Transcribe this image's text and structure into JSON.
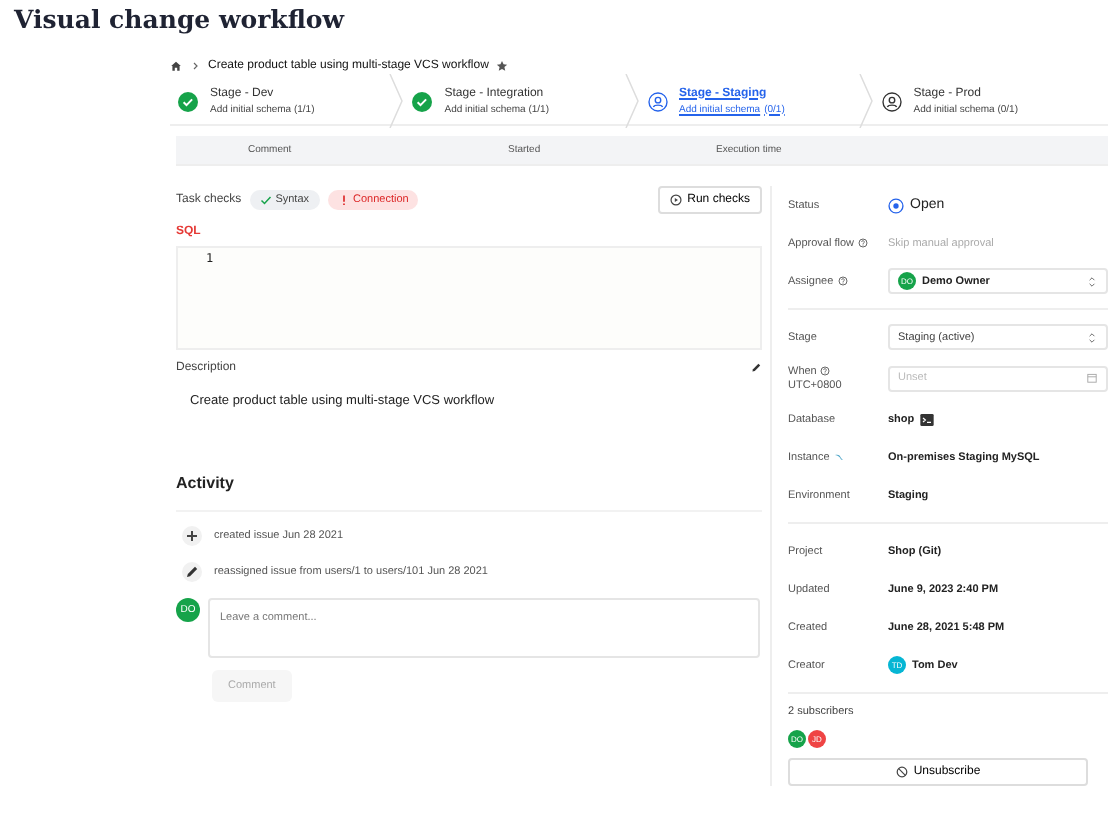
{
  "page_title": "Visual change workflow",
  "breadcrumb": {
    "title": "Create product table using multi-stage VCS workflow",
    "starred": true
  },
  "stages": [
    {
      "name": "Stage - Dev",
      "task": "Add initial schema (1/1)",
      "kind": "done",
      "selected": false
    },
    {
      "name": "Stage - Integration",
      "task": "Add initial schema (1/1)",
      "kind": "done",
      "selected": false
    },
    {
      "name": "Stage - Staging",
      "task": "Add initial schema",
      "count": "(0/1)",
      "kind": "active",
      "selected": true
    },
    {
      "name": "Stage - Prod",
      "task": "Add initial schema (0/1)",
      "kind": "pending",
      "selected": false
    }
  ],
  "table": {
    "columns": [
      "Comment",
      "Started",
      "Execution time"
    ]
  },
  "task_checks": {
    "label": "Task checks",
    "checks": [
      {
        "label": "Syntax",
        "kind": "success"
      },
      {
        "label": "Connection",
        "kind": "error"
      }
    ],
    "run_button": "Run checks"
  },
  "sql": {
    "label": "SQL",
    "lines": [
      "1"
    ]
  },
  "description": {
    "label": "Description",
    "text": "Create product table using multi-stage VCS workflow"
  },
  "activity": {
    "title": "Activity",
    "events": [
      {
        "kind": "create",
        "text": "created issue Jun 28 2021"
      },
      {
        "kind": "edit",
        "text": "reassigned issue from users/1 to users/101 Jun 28 2021"
      }
    ],
    "avatar": {
      "initials": "DO",
      "color": "#16a34a"
    },
    "comment_placeholder": "Leave a comment...",
    "comment_button": "Comment"
  },
  "sidebar": {
    "rows": [
      {
        "kind": "status",
        "label": "Status",
        "value": "Open"
      },
      {
        "kind": "muted",
        "label": "Approval flow",
        "help": true,
        "value": "Skip manual approval"
      },
      {
        "kind": "select",
        "label": "Assignee",
        "help": true,
        "value": "Demo Owner",
        "avatar": {
          "initials": "DO",
          "color": "#16a34a"
        }
      },
      {
        "kind": "divider"
      },
      {
        "kind": "select",
        "label": "Stage",
        "value": "Staging (active)"
      },
      {
        "kind": "date",
        "label": "When",
        "help": true,
        "sublabel": "UTC+0800",
        "placeholder": "Unset"
      },
      {
        "kind": "text",
        "label": "Database",
        "value": "shop",
        "terminal": true
      },
      {
        "kind": "text",
        "label": "Instance",
        "value": "On-premises Staging MySQL",
        "engine": true
      },
      {
        "kind": "text",
        "label": "Environment",
        "value": "Staging"
      },
      {
        "kind": "divider"
      },
      {
        "kind": "text",
        "label": "Project",
        "value": "Shop (Git)"
      },
      {
        "kind": "text",
        "label": "Updated",
        "value": "June 9, 2023 2:40 PM"
      },
      {
        "kind": "text",
        "label": "Created",
        "value": "June 28, 2021 5:48 PM"
      },
      {
        "kind": "person",
        "label": "Creator",
        "value": "Tom Dev",
        "avatar": {
          "initials": "TD",
          "color": "#06b6d4"
        }
      },
      {
        "kind": "divider"
      }
    ],
    "subscribers": {
      "label": "2 subscribers",
      "avatars": [
        {
          "initials": "DO",
          "color": "#16a34a"
        },
        {
          "initials": "JD",
          "color": "#ef4444"
        }
      ],
      "button": "Unsubscribe"
    }
  }
}
